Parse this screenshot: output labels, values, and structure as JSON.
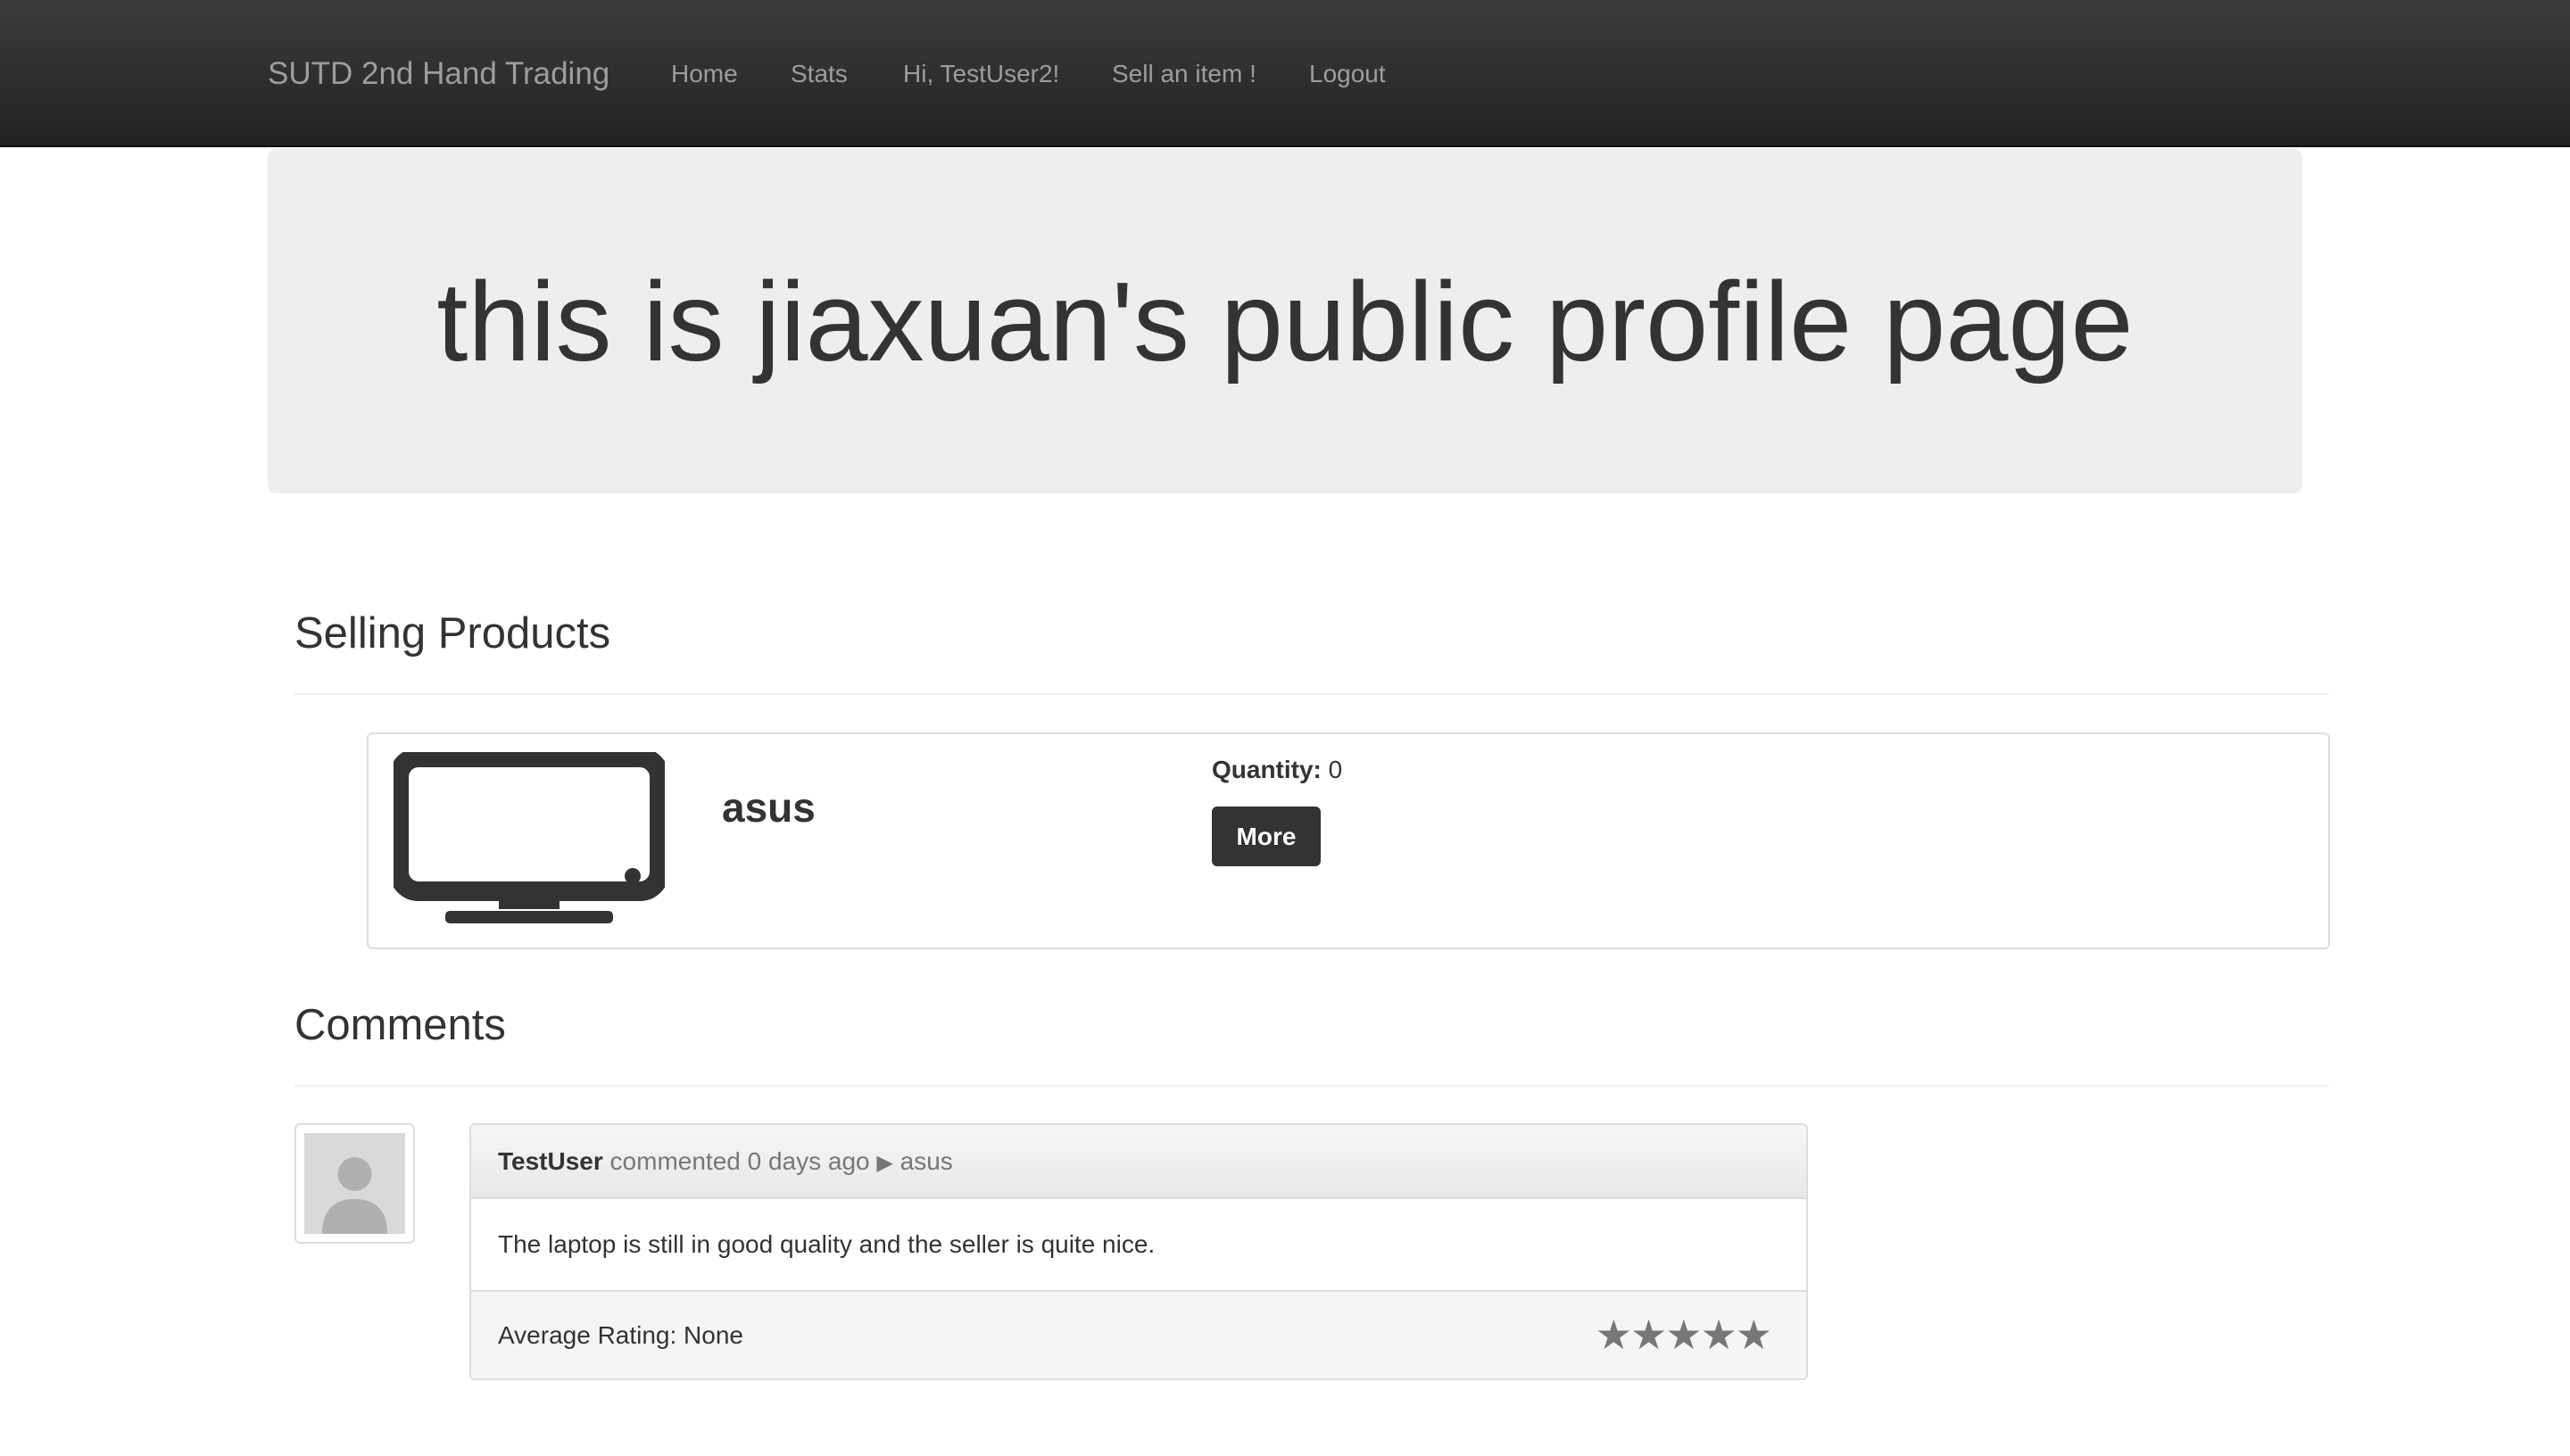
{
  "navbar": {
    "brand": "SUTD 2nd Hand Trading",
    "links": [
      {
        "label": "Home"
      },
      {
        "label": "Stats"
      },
      {
        "label": "Hi, TestUser2!"
      },
      {
        "label": "Sell an item !"
      },
      {
        "label": "Logout"
      }
    ],
    "background": "#222222",
    "link_color": "#9d9d9d"
  },
  "jumbotron": {
    "title": "this is jiaxuan's public profile page"
  },
  "selling_section": {
    "title": "Selling Products",
    "products": [
      {
        "icon": "monitor-icon",
        "name": "asus",
        "quantity_label": "Quantity:",
        "quantity_value": "0",
        "button_label": "More"
      }
    ]
  },
  "comments_section": {
    "title": "Comments",
    "comments": [
      {
        "avatar_icon": "user-placeholder-icon",
        "author": "TestUser",
        "action": "commented 0 days ago",
        "arrow_icon": "play-arrow-icon",
        "arrow_glyph": "▶",
        "target": "asus",
        "text": "The laptop is still in good quality and the seller is quite nice.",
        "rating_text": "Average Rating: None",
        "stars": "★★★★★",
        "star_count": 5
      }
    ]
  }
}
